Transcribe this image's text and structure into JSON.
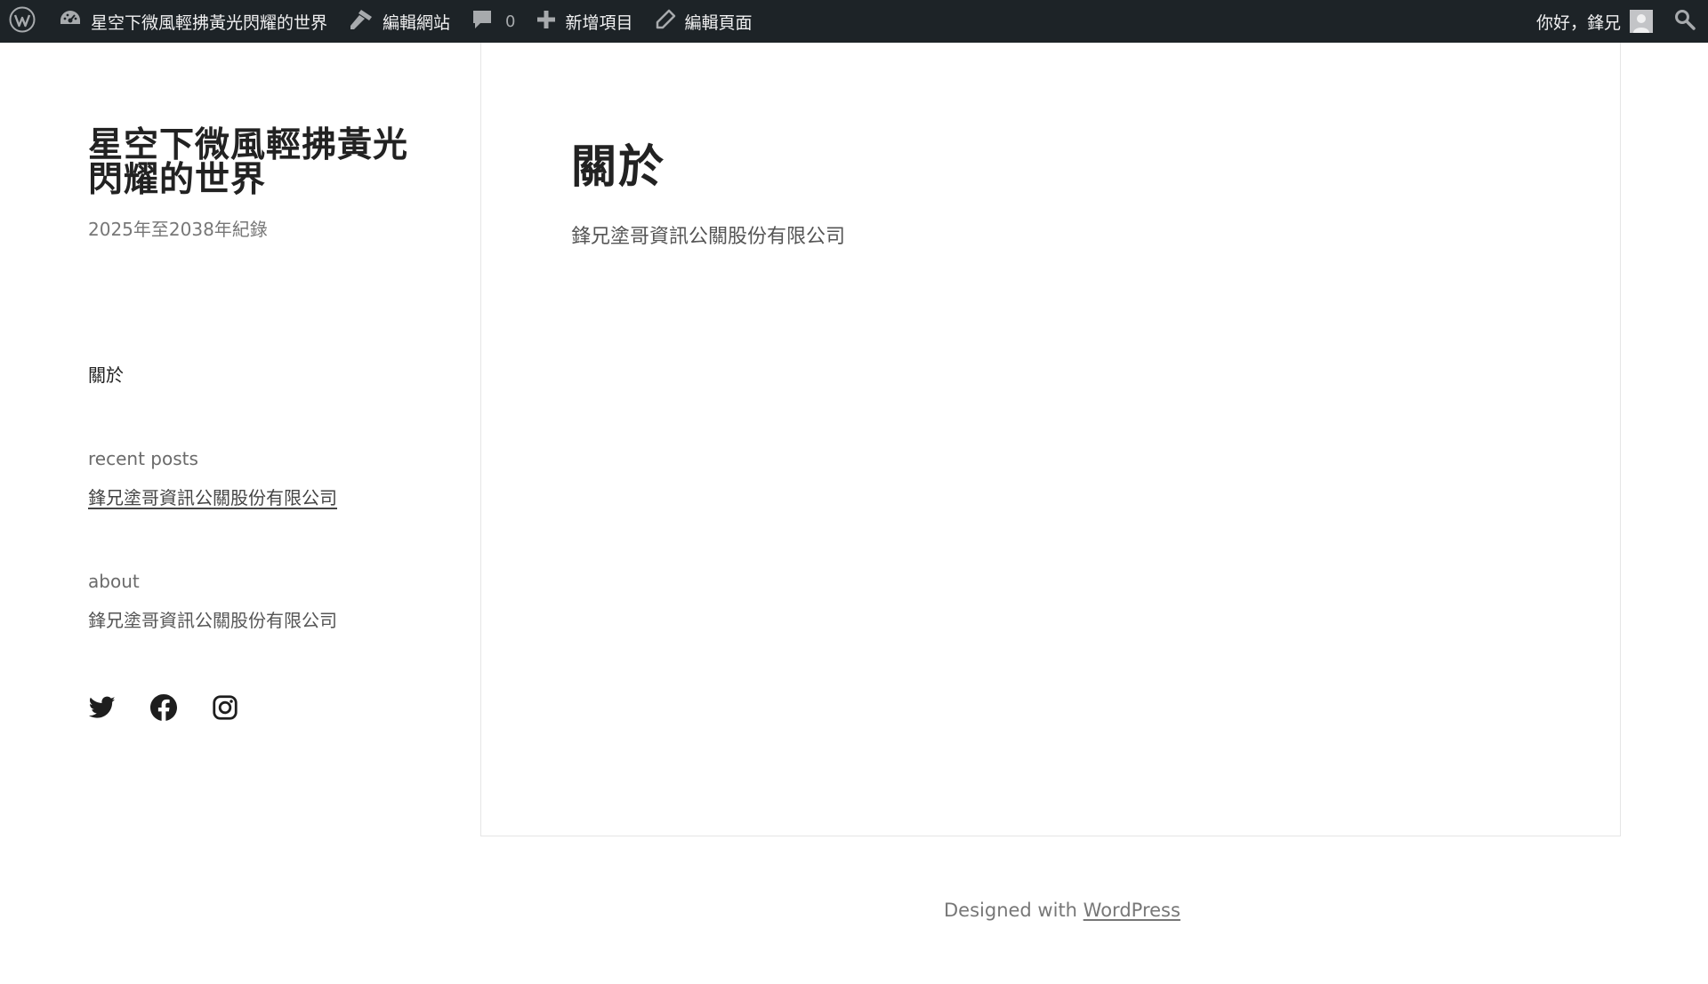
{
  "admin_bar": {
    "site_name": "星空下微風輕拂黃光閃耀的世界",
    "customize": "編輯網站",
    "comments_count": "0",
    "new_item": "新增項目",
    "edit_page": "編輯頁面",
    "greeting": "你好，鋒兄",
    "bg_color": "#1d2327"
  },
  "sidebar": {
    "site_title": "星空下微風輕拂黃光閃耀的世界",
    "tagline": "2025年至2038年紀錄",
    "nav_items": [
      "關於"
    ],
    "recent_posts_title": "recent posts",
    "recent_posts": [
      "鋒兄塗哥資訊公關股份有限公司"
    ],
    "about_title": "about",
    "about_text": "鋒兄塗哥資訊公關股份有限公司",
    "social_icons": [
      "twitter-icon",
      "facebook-icon",
      "instagram-icon"
    ]
  },
  "main": {
    "title": "關於",
    "body": "鋒兄塗哥資訊公關股份有限公司"
  },
  "footer": {
    "prefix": "Designed with ",
    "link": "WordPress"
  }
}
